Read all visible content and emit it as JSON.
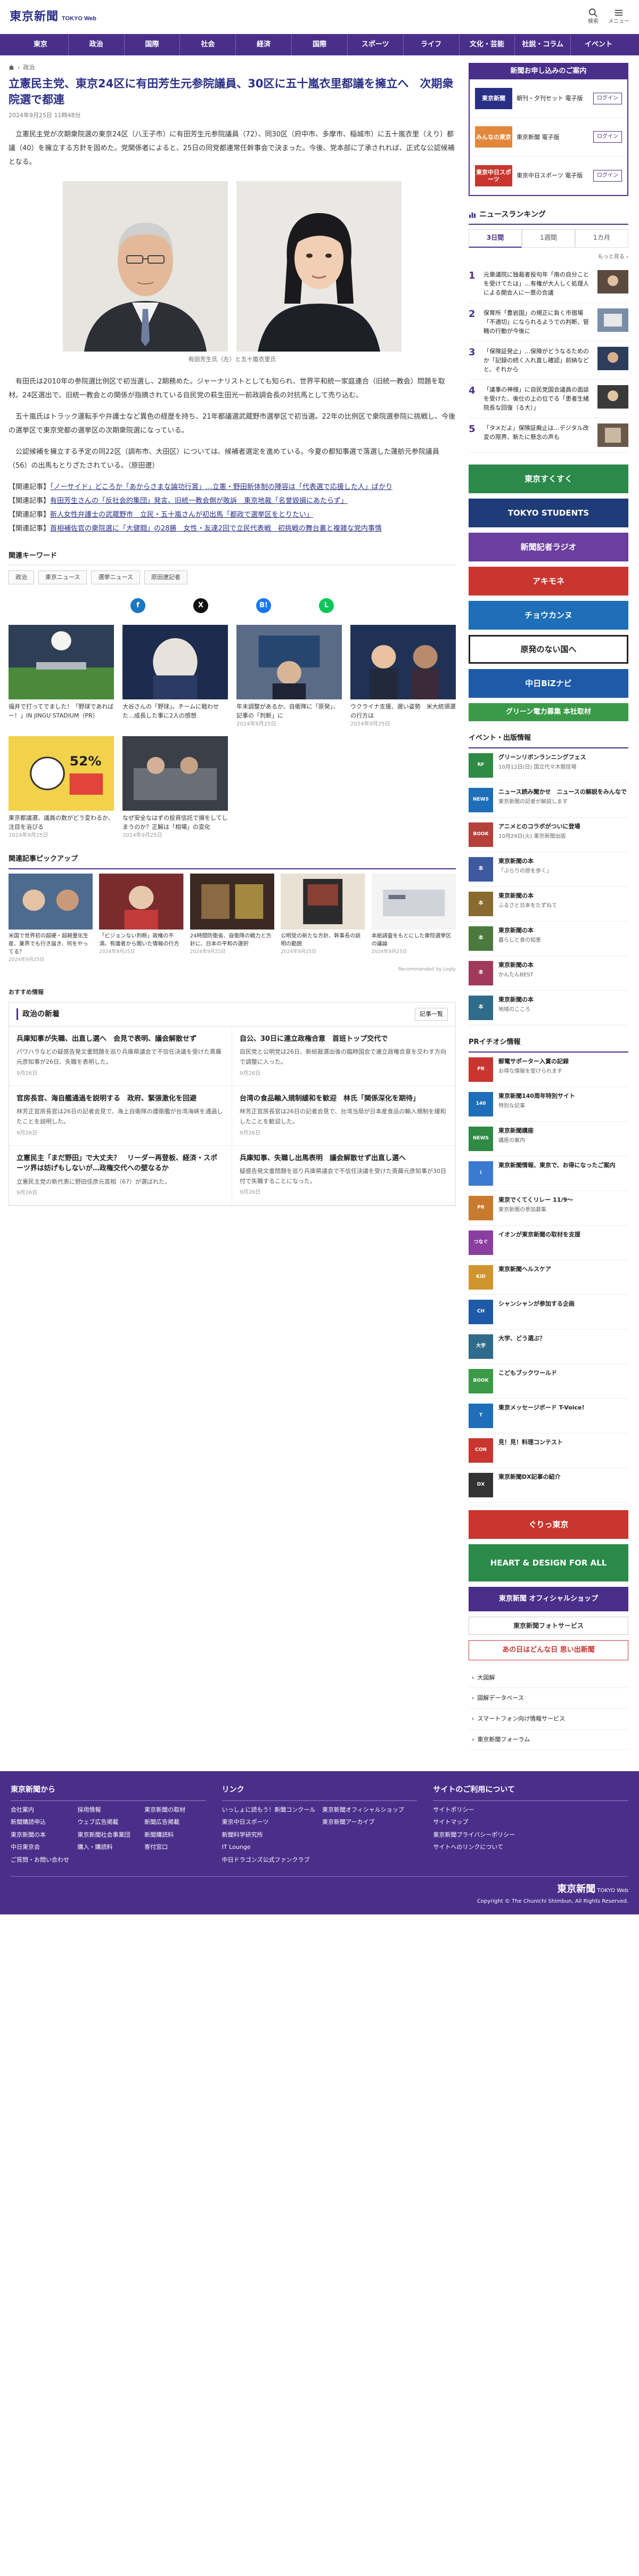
{
  "header": {
    "logo_main": "東京新聞",
    "logo_sub": "TOKYO Web",
    "tool_search": "検索",
    "tool_menu": "メニュー"
  },
  "nav": [
    "東京",
    "政治",
    "国際",
    "社会",
    "経済",
    "国際",
    "スポーツ",
    "ライフ",
    "文化・芸能",
    "社説・コラム",
    "イベント"
  ],
  "article": {
    "breadcrumb_home": "トップ",
    "breadcrumb_sec": "政治",
    "title": "立憲民主党、東京24区に有田芳生元参院議員、30区に五十嵐衣里都議を擁立へ　次期衆院選で都連",
    "date": "2024年9月25日 11時48分",
    "paragraphs": [
      "立憲民主党が次期衆院選の東京24区（八王子市）に有田芳生元参院議員（72）、同30区（府中市、多摩市、稲城市）に五十嵐衣里（えり）都議（40）を擁立する方針を固めた。党関係者によると、25日の同党都連常任幹事会で決まった。今後、党本部に了承されれば、正式な公認候補となる。",
      "有田氏は2010年の参院選比例区で初当選し、2期務めた。ジャーナリストとしても知られ、世界平和統一家庭連合（旧統一教会）問題を取材。24区選出で、旧統一教会との関係が指摘されている自民党の萩生田光一前政調会長の対抗馬として売り込む。",
      "五十嵐氏はトラック運転手や弁護士など異色の経歴を持ち、21年都議選武蔵野市選挙区で初当選。22年の比例区で衆院選参院に挑戦し、今後の選挙区で東京党都の選挙区の次期衆院選になっている。",
      "公認候補を擁立する予定の同22区（調布市、大田区）については、候補者選定を進めている。今夏の都知事選で落選した蓮舫元参院議員（56）の出馬もとりざたされている。（原田遼）"
    ],
    "caption": "有田芳生氏（左）と五十嵐衣里氏",
    "related_tag": "【関連記事】",
    "related_links": [
      "「ノーサイド」どころか「あからさまな論功行賞」…立憲・野田新体制の陣容は「代表選で応援した人」ばかり",
      "有田芳生さんの「反社会的集団」発言、旧統一教会側が敗訴　東京地裁「名誉毀損にあたらず」",
      "新人女性弁護士の武蔵野市　立民・五十嵐さんが初出馬「都政で選挙区をとりたい」",
      "首相補佐官の衆院選に「大健闘」の28勝　女性・友達2回で立民代表戦　初挑戦の舞台裏と複雑な党内事情"
    ]
  },
  "keywords": {
    "head": "関連キーワード",
    "items": [
      "政治",
      "東京ニュース",
      "選挙ニュース",
      "原田遼記者"
    ]
  },
  "share": {
    "fb": "f",
    "x": "X",
    "line": "L",
    "hatena": "B!"
  },
  "related_cards": [
    {
      "title": "福井で打ってでました！「野球であればー！」IN JINGU STADIUM（PR）",
      "date": ""
    },
    {
      "title": "大谷さんの「野球」。チームに戦わせた…成長した事に2人の感想",
      "date": ""
    },
    {
      "title": "年末調整があるか、自衛隊に「原発」、記事の「判断」に",
      "date": "2024年9月25日"
    },
    {
      "title": "ウクライナ支援、遅い姿勢　米大統領選の行方は",
      "date": "2024年9月25日"
    },
    {
      "title": "東京都議選、議員の数がどう変わるか、注目を浴びる",
      "date": "2024年9月25日"
    },
    {
      "title": "なぜ安全なはずの投資信託で損をしてしまうのか？正解は「相場」の変化",
      "date": "2024年9月25日"
    }
  ],
  "pickup": {
    "head": "関連記事ピックアップ",
    "items": [
      {
        "title": "米国で世界初の超硬・超軽量化生産、業界でも行き届き、何をやってる？",
        "date": "2024年9月25日"
      },
      {
        "title": "「ビジョンない判断」政権の不満、有識者から聞いた情報の行方",
        "date": "2024年9月25日"
      },
      {
        "title": "24時間防衛省、自衛隊の戦力と方針に、日本の平和の選択",
        "date": "2024年9月25日"
      },
      {
        "title": "公明党の新たな方針、幹事長の説明の範囲",
        "date": "2024年9月25日"
      },
      {
        "title": "本紙調査をもとにした衆院選挙区の議論",
        "date": "2024年9月25日"
      }
    ],
    "rec_by": "Recommended by Logly"
  },
  "recommend_label": "おすすめ情報",
  "politics": {
    "title": "政治の新着",
    "more": "記事一覧",
    "items": [
      {
        "title": "兵庫知事が失職、出直し選へ　会見で表明、議会解散せず",
        "desc": "パワハラなどの疑惑告発文書問題を巡り兵庫県議会で不信任決議を受けた斎藤元彦知事が26日、失職を表明した。",
        "date": "9月26日"
      },
      {
        "title": "自公、30日に連立政権合意　首班トップ交代で",
        "desc": "自民党と公明党は26日、新総裁選出後の臨時国会で連立政権合意を交わす方向で調整に入った。",
        "date": "9月26日"
      },
      {
        "title": "官房長官、海自艦通過を説明する　政府、緊張激化を回避",
        "desc": "林芳正官房長官は26日の記者会見で、海上自衛隊の護衛艦が台湾海峡を通過したことを説明した。",
        "date": "9月26日"
      },
      {
        "title": "台湾の食品輸入規制緩和を歓迎　林氏「関係深化を期待」",
        "desc": "林芳正官房長官は26日の記者会見で、台湾当局が日本産食品の輸入規制を緩和したことを歓迎した。",
        "date": "9月26日"
      },
      {
        "title": "立憲民主「まだ野田」で大丈夫？　リーダー再登板、経済・スポーツ界は妨げもしないが…政権交代への壁なるか",
        "desc": "立憲民主党の新代表に野田佳彦元首相（67）が選ばれた。",
        "date": "9月26日"
      },
      {
        "title": "兵庫知事、失職し出馬表明　議会解散せず出直し選へ",
        "desc": "疑惑告発文書問題を巡り兵庫県議会で不信任決議を受けた斎藤元彦知事が30日付で失職することになった。",
        "date": "9月26日"
      }
    ]
  },
  "side": {
    "ad_head": "新聞お申し込みのご案内",
    "ad_rows": [
      {
        "badge": "東京新聞",
        "text": "朝刊・夕刊セット 電子版",
        "btn": "ログイン"
      },
      {
        "badge": "みんなの東京",
        "text": "東京新聞 電子版",
        "btn": "ログイン"
      },
      {
        "badge": "東京中日スポーツ",
        "text": "東京中日スポーツ 電子版",
        "btn": "ログイン"
      }
    ],
    "rank_head": "ニュースランキング",
    "rank_tabs": [
      "3日間",
      "1週間",
      "1カ月"
    ],
    "rank_more": "もっと見る",
    "rank_items": [
      "元衆議院に独裁者投句年「南の自分ことを受けてたは」…有権が大人しく処理人による開会人に一票の合議",
      "保育所「豊岩国」の規正に負く市宿場「不適切」になられるようでの判断、管轄の行動が今後に",
      "「保険証発止」…保険がどうなるためのか「記録の続く入れ直し確認」前納などと、それから",
      "「議事の神様」に自民党国会議員の面談を受けた、後仕の上の位でる「患者生緒院長な回復（る大）」",
      "「タメだよ」保険証廃止は…デジタル改変の限界、新たに懸念の声も"
    ],
    "banners": [
      {
        "text": "東京すくすく",
        "color": "#2b8a4a"
      },
      {
        "text": "TOKYO STUDENTS",
        "color": "#1f3b78"
      },
      {
        "text": "新聞記者ラジオ",
        "color": "#6b3fa0"
      },
      {
        "text": "アキモネ",
        "color": "#c8362f"
      },
      {
        "text": "チョウカンヌ",
        "color": "#1e6fb8"
      },
      {
        "text": "原発のない国へ",
        "color": "#222222"
      },
      {
        "text": "中日BiZナビ",
        "color": "#1e5aa8"
      },
      {
        "text": "グリーン電力募集 本社取材",
        "color": "#3b9a48"
      }
    ],
    "event_head": "イベント・出版情報",
    "events": [
      {
        "thumb": "RF",
        "color": "#2f8a44",
        "title": "グリーンリボンランニングフェス",
        "desc": "10月12日(日) 国立代々木競技場"
      },
      {
        "thumb": "NEWS",
        "color": "#1e6fb8",
        "title": "ニュース読み聞かせ　ニュースの解説をみんなで",
        "desc": "東京新聞の記者が解説します"
      },
      {
        "thumb": "BOOK",
        "color": "#b3403a",
        "title": "アニメとのコラボがついに登場",
        "desc": "10月29日(火) 東京新聞出版"
      },
      {
        "thumb": "本",
        "color": "#3d5aa0",
        "title": "東京新聞の本",
        "desc": "「ぶらりの旅を歩く」"
      },
      {
        "thumb": "本",
        "color": "#8a6b2f",
        "title": "東京新聞の本",
        "desc": "ふるさと日本をたずねて"
      },
      {
        "thumb": "本",
        "color": "#4a7a3d",
        "title": "東京新聞の本",
        "desc": "暮らしと食の知恵"
      },
      {
        "thumb": "本",
        "color": "#a03a5d",
        "title": "東京新聞の本",
        "desc": "かんたんBEST"
      },
      {
        "thumb": "本",
        "color": "#2f6b8a",
        "title": "東京新聞の本",
        "desc": "地域のこころ"
      }
    ],
    "pr_head": "PRイチオシ情報",
    "prs": [
      {
        "thumb": "PR",
        "color": "#c8362f",
        "title": "郵電サポーター入賞の記録",
        "desc": "お得な情報を受けられます"
      },
      {
        "thumb": "140",
        "color": "#1e6fb8",
        "title": "東京新聞140周年特別サイト",
        "desc": "特別な記事"
      },
      {
        "thumb": "NEWS",
        "color": "#2f8a44",
        "title": "東京新聞講座",
        "desc": "講座の案内"
      },
      {
        "thumb": "i",
        "color": "#3b7ad1",
        "title": "東京新聞情報、東京で、お得になったご案内",
        "desc": ""
      },
      {
        "thumb": "PR",
        "color": "#c87a2f",
        "title": "東京でくてくリレー 11/9〜",
        "desc": "東京新聞の参加募集"
      },
      {
        "thumb": "つなぐ",
        "color": "#8a3fa0",
        "title": "イオンが東京新聞の取材を支援",
        "desc": ""
      },
      {
        "thumb": "KID",
        "color": "#d1952f",
        "title": "東京新聞ヘルスケア",
        "desc": ""
      },
      {
        "thumb": "CH",
        "color": "#1e5aa8",
        "title": "シャンシャンが参加する企画",
        "desc": ""
      },
      {
        "thumb": "大学",
        "color": "#2f6b8a",
        "title": "大学、どう選ぶ？",
        "desc": ""
      },
      {
        "thumb": "BOOK",
        "color": "#3b9a48",
        "title": "こどもブックワールド",
        "desc": ""
      },
      {
        "thumb": "T",
        "color": "#1e6fb8",
        "title": "東京メッセージボード T-Voice!",
        "desc": ""
      },
      {
        "thumb": "CON",
        "color": "#c8362f",
        "title": "見！見！料理コンテスト",
        "desc": ""
      },
      {
        "thumb": "DX",
        "color": "#333333",
        "title": "東京新聞DX記事の紹介",
        "desc": ""
      }
    ],
    "bottom_banners": [
      {
        "text": "ぐりっ東京",
        "color": "#c8362f"
      },
      {
        "text": "HEART & DESIGN FOR ALL",
        "color": "#2b8a4a"
      },
      {
        "text": "東京新聞 オフィシャルショップ",
        "color": "#4a2f8a"
      },
      {
        "text": "東京新聞フォトサービス",
        "color": "#555555"
      },
      {
        "text": "あの日はどんな日 思い出新聞",
        "color": "#c8362f"
      }
    ],
    "links": [
      "大図解",
      "図解データベース",
      "スマートフォン向け情報サービス",
      "東京新聞フォーラム"
    ]
  },
  "footer": {
    "col1_head": "東京新聞から",
    "col1": [
      "会社案内",
      "採用情報",
      "東京新聞の取材",
      "新聞購読申込",
      "ウェブ広告掲載",
      "新聞広告掲載",
      "東京新聞の本",
      "東京新聞社会事業団",
      "新聞購読料",
      "中日東京会",
      "購入・購読料",
      "寄付窓口",
      "ご質問・お問い合わせ"
    ],
    "col2_head": "リンク",
    "col2": [
      "いっしょに読もう！新聞コンクール",
      "東京新聞オフィシャルショップ",
      "東京中日スポーツ",
      "東京新聞アーカイブ",
      "新聞科学研究所",
      "",
      "IT Lounge",
      "",
      "中日ドラゴンズ公式ファンクラブ",
      ""
    ],
    "col3_head": "サイトのご利用について",
    "col3": [
      "サイトポリシー",
      "サイトマップ",
      "東京新聞プライバシーポリシー",
      "サイトへのリンクについて"
    ],
    "logo": "東京新聞",
    "logo_sub": "TOKYO Web",
    "copy": "Copyright © The Chunichi Shimbun, All Rights Reserved."
  }
}
